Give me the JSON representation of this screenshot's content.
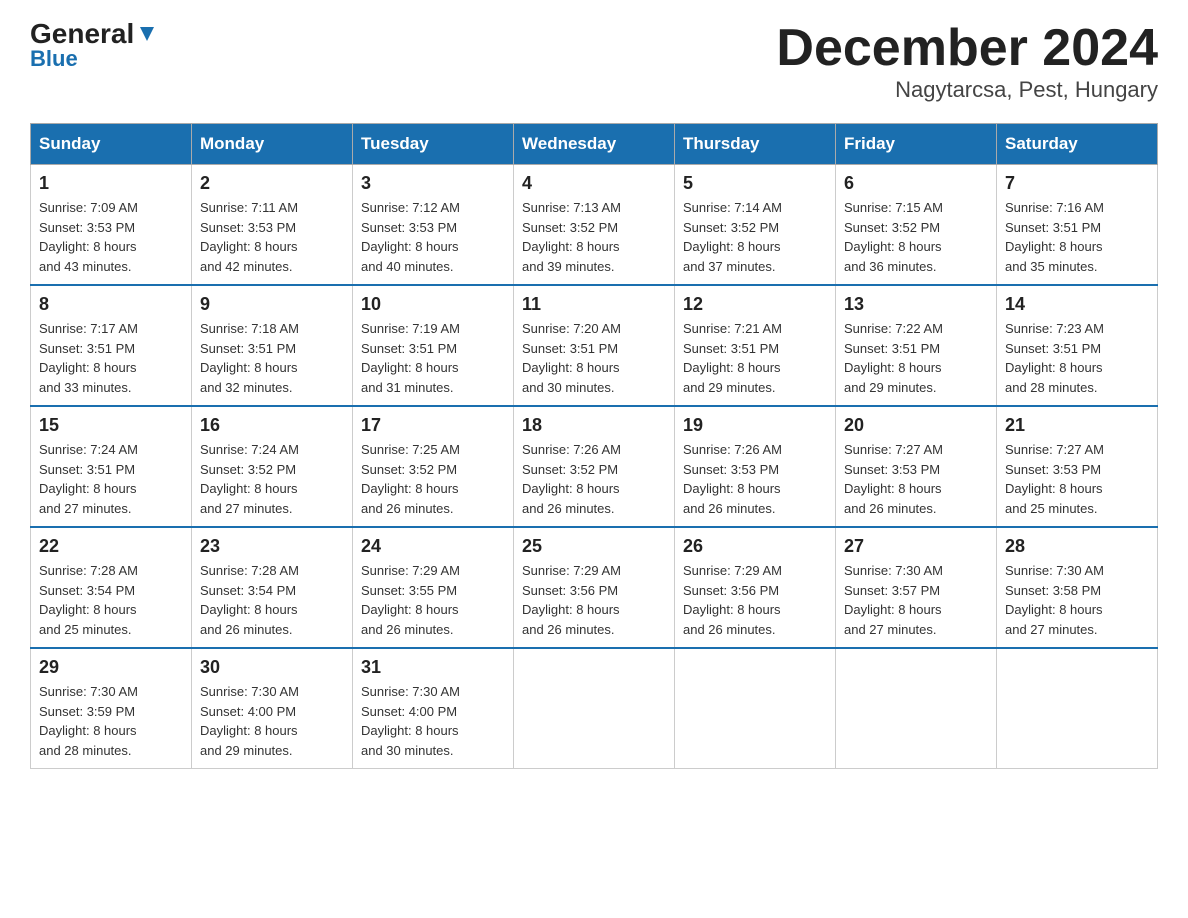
{
  "header": {
    "logo_general": "General",
    "logo_blue": "Blue",
    "title": "December 2024",
    "subtitle": "Nagytarcsa, Pest, Hungary"
  },
  "days_of_week": [
    "Sunday",
    "Monday",
    "Tuesday",
    "Wednesday",
    "Thursday",
    "Friday",
    "Saturday"
  ],
  "weeks": [
    [
      {
        "day": "1",
        "sunrise": "7:09 AM",
        "sunset": "3:53 PM",
        "daylight": "8 hours and 43 minutes."
      },
      {
        "day": "2",
        "sunrise": "7:11 AM",
        "sunset": "3:53 PM",
        "daylight": "8 hours and 42 minutes."
      },
      {
        "day": "3",
        "sunrise": "7:12 AM",
        "sunset": "3:53 PM",
        "daylight": "8 hours and 40 minutes."
      },
      {
        "day": "4",
        "sunrise": "7:13 AM",
        "sunset": "3:52 PM",
        "daylight": "8 hours and 39 minutes."
      },
      {
        "day": "5",
        "sunrise": "7:14 AM",
        "sunset": "3:52 PM",
        "daylight": "8 hours and 37 minutes."
      },
      {
        "day": "6",
        "sunrise": "7:15 AM",
        "sunset": "3:52 PM",
        "daylight": "8 hours and 36 minutes."
      },
      {
        "day": "7",
        "sunrise": "7:16 AM",
        "sunset": "3:51 PM",
        "daylight": "8 hours and 35 minutes."
      }
    ],
    [
      {
        "day": "8",
        "sunrise": "7:17 AM",
        "sunset": "3:51 PM",
        "daylight": "8 hours and 33 minutes."
      },
      {
        "day": "9",
        "sunrise": "7:18 AM",
        "sunset": "3:51 PM",
        "daylight": "8 hours and 32 minutes."
      },
      {
        "day": "10",
        "sunrise": "7:19 AM",
        "sunset": "3:51 PM",
        "daylight": "8 hours and 31 minutes."
      },
      {
        "day": "11",
        "sunrise": "7:20 AM",
        "sunset": "3:51 PM",
        "daylight": "8 hours and 30 minutes."
      },
      {
        "day": "12",
        "sunrise": "7:21 AM",
        "sunset": "3:51 PM",
        "daylight": "8 hours and 29 minutes."
      },
      {
        "day": "13",
        "sunrise": "7:22 AM",
        "sunset": "3:51 PM",
        "daylight": "8 hours and 29 minutes."
      },
      {
        "day": "14",
        "sunrise": "7:23 AM",
        "sunset": "3:51 PM",
        "daylight": "8 hours and 28 minutes."
      }
    ],
    [
      {
        "day": "15",
        "sunrise": "7:24 AM",
        "sunset": "3:51 PM",
        "daylight": "8 hours and 27 minutes."
      },
      {
        "day": "16",
        "sunrise": "7:24 AM",
        "sunset": "3:52 PM",
        "daylight": "8 hours and 27 minutes."
      },
      {
        "day": "17",
        "sunrise": "7:25 AM",
        "sunset": "3:52 PM",
        "daylight": "8 hours and 26 minutes."
      },
      {
        "day": "18",
        "sunrise": "7:26 AM",
        "sunset": "3:52 PM",
        "daylight": "8 hours and 26 minutes."
      },
      {
        "day": "19",
        "sunrise": "7:26 AM",
        "sunset": "3:53 PM",
        "daylight": "8 hours and 26 minutes."
      },
      {
        "day": "20",
        "sunrise": "7:27 AM",
        "sunset": "3:53 PM",
        "daylight": "8 hours and 26 minutes."
      },
      {
        "day": "21",
        "sunrise": "7:27 AM",
        "sunset": "3:53 PM",
        "daylight": "8 hours and 25 minutes."
      }
    ],
    [
      {
        "day": "22",
        "sunrise": "7:28 AM",
        "sunset": "3:54 PM",
        "daylight": "8 hours and 25 minutes."
      },
      {
        "day": "23",
        "sunrise": "7:28 AM",
        "sunset": "3:54 PM",
        "daylight": "8 hours and 26 minutes."
      },
      {
        "day": "24",
        "sunrise": "7:29 AM",
        "sunset": "3:55 PM",
        "daylight": "8 hours and 26 minutes."
      },
      {
        "day": "25",
        "sunrise": "7:29 AM",
        "sunset": "3:56 PM",
        "daylight": "8 hours and 26 minutes."
      },
      {
        "day": "26",
        "sunrise": "7:29 AM",
        "sunset": "3:56 PM",
        "daylight": "8 hours and 26 minutes."
      },
      {
        "day": "27",
        "sunrise": "7:30 AM",
        "sunset": "3:57 PM",
        "daylight": "8 hours and 27 minutes."
      },
      {
        "day": "28",
        "sunrise": "7:30 AM",
        "sunset": "3:58 PM",
        "daylight": "8 hours and 27 minutes."
      }
    ],
    [
      {
        "day": "29",
        "sunrise": "7:30 AM",
        "sunset": "3:59 PM",
        "daylight": "8 hours and 28 minutes."
      },
      {
        "day": "30",
        "sunrise": "7:30 AM",
        "sunset": "4:00 PM",
        "daylight": "8 hours and 29 minutes."
      },
      {
        "day": "31",
        "sunrise": "7:30 AM",
        "sunset": "4:00 PM",
        "daylight": "8 hours and 30 minutes."
      },
      null,
      null,
      null,
      null
    ]
  ],
  "labels": {
    "sunrise": "Sunrise:",
    "sunset": "Sunset:",
    "daylight": "Daylight:"
  }
}
